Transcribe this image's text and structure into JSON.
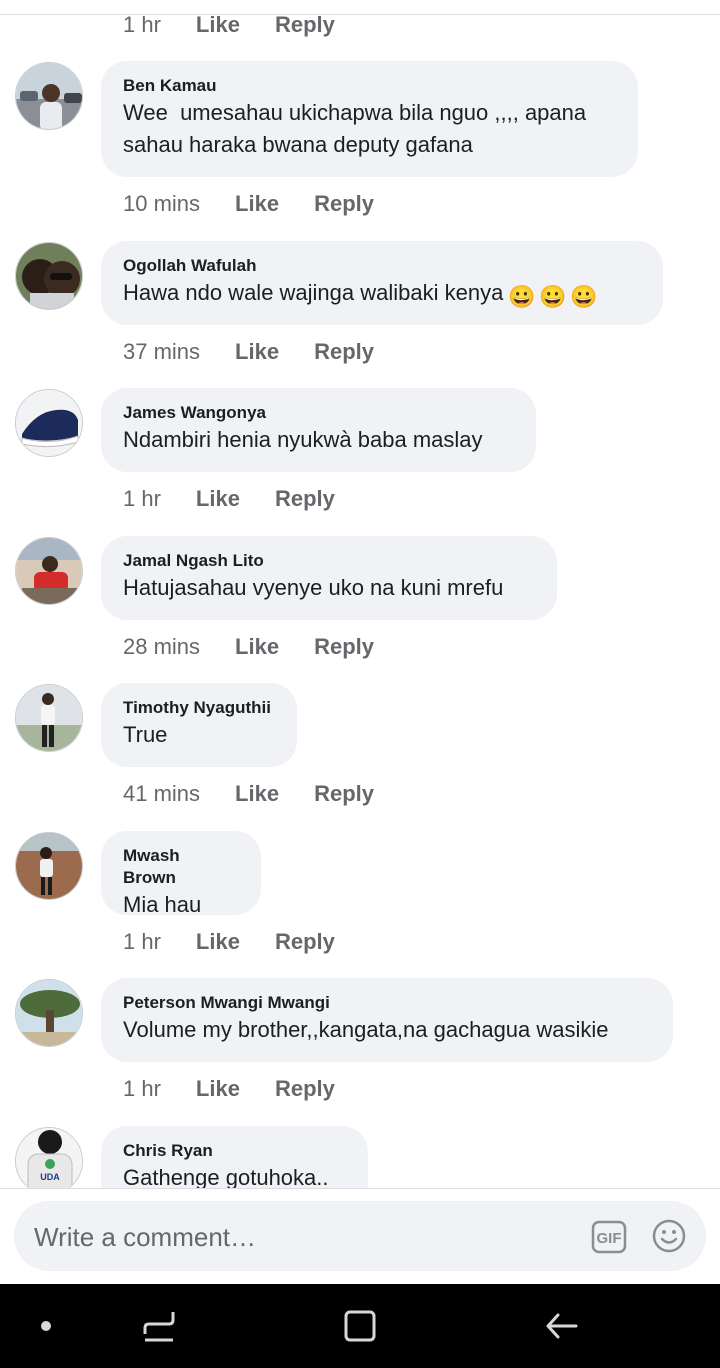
{
  "top_meta": {
    "time": "1 hr",
    "like": "Like",
    "reply": "Reply"
  },
  "comments": [
    {
      "author": "Ben Kamau",
      "text": "Wee  umesahau ukichapwa bila nguo ,,,, apana\nsahau haraka bwana deputy gafana",
      "time": "10 mins",
      "like": "Like",
      "reply": "Reply",
      "avatar_icon": "profile-photo-man-with-cars"
    },
    {
      "author": "Ogollah Wafulah",
      "text": "Hawa ndo wale wajinga walibaki kenya",
      "emojis": [
        "😀",
        "😀",
        "😀"
      ],
      "time": "37 mins",
      "like": "Like",
      "reply": "Reply",
      "avatar_icon": "profile-photo-couple-selfie"
    },
    {
      "author": "James Wangonya",
      "text": "Ndambiri henia nyukwà baba maslay",
      "time": "1 hr",
      "like": "Like",
      "reply": "Reply",
      "avatar_icon": "profile-photo-shoe"
    },
    {
      "author": "Jamal Ngash Lito",
      "text": "Hatujasahau vyenye uko na kuni mrefu",
      "time": "28 mins",
      "like": "Like",
      "reply": "Reply",
      "avatar_icon": "profile-photo-red-shirt"
    },
    {
      "author": "Timothy Nyaguthii",
      "text": "True",
      "time": "41 mins",
      "like": "Like",
      "reply": "Reply",
      "avatar_icon": "profile-photo-standing-man"
    },
    {
      "author": "Mwash Brown",
      "text": "Mia hau",
      "time": "1 hr",
      "like": "Like",
      "reply": "Reply",
      "avatar_icon": "profile-photo-man-red-soil"
    },
    {
      "author": "Peterson Mwangi Mwangi",
      "text": "Volume my brother,,kangata,na gachagua wasikie",
      "time": "1 hr",
      "like": "Like",
      "reply": "Reply",
      "avatar_icon": "profile-photo-tree"
    },
    {
      "author": "Chris Ryan",
      "text": "Gathenge gotuhoka..",
      "avatar_icon": "profile-photo-uda-shirt",
      "avatar_text": "UDA"
    }
  ],
  "composer": {
    "placeholder": "Write a comment…",
    "gif_label": "GIF",
    "gif_icon": "gif-icon",
    "emoji_icon": "smiley-icon"
  },
  "colors": {
    "bubble": "#f0f2f5",
    "meta_text": "#65676b",
    "text": "#1c1e21",
    "navbar": "#000000"
  },
  "navbar": {
    "icons": [
      "dot-icon",
      "recent-apps-icon",
      "home-icon",
      "back-icon"
    ]
  }
}
